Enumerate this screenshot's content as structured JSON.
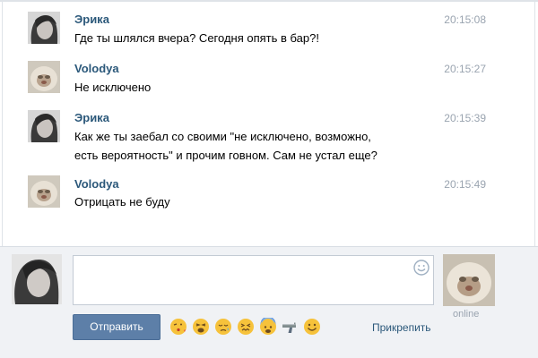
{
  "messages": [
    {
      "author": "Эрика",
      "time": "20:15:08",
      "text": "Где ты шлялся вчера? Сегодня опять в бар?!",
      "avatar": "woman-photo-avatar"
    },
    {
      "author": "Volodya",
      "time": "20:15:27",
      "text": "Не исключено",
      "avatar": "cat-photo-avatar"
    },
    {
      "author": "Эрика",
      "time": "20:15:39",
      "text": "Как же ты заебал со своими \"не исключено, возможно, есть вероятность\" и прочим говном. Сам не устал еще?",
      "avatar": "woman-photo-avatar"
    },
    {
      "author": "Volodya",
      "time": "20:15:49",
      "text": "Отрицать не буду",
      "avatar": "cat-photo-avatar"
    }
  ],
  "composer": {
    "input_value": "",
    "send_label": "Отправить",
    "attach_label": "Прикрепить",
    "smiley_icon": "smiley-icon",
    "emojis": [
      "kiss-emoji",
      "tired-emoji",
      "sad-relieved-emoji",
      "confounded-emoji",
      "fearful-emoji",
      "pistol-emoji",
      "smile-emoji"
    ]
  },
  "peer": {
    "status": "online"
  },
  "colors": {
    "author": "#2b587a",
    "time": "#9aa4b0",
    "send_button": "#5d7fa8",
    "composer_bg": "#f0f2f5"
  }
}
